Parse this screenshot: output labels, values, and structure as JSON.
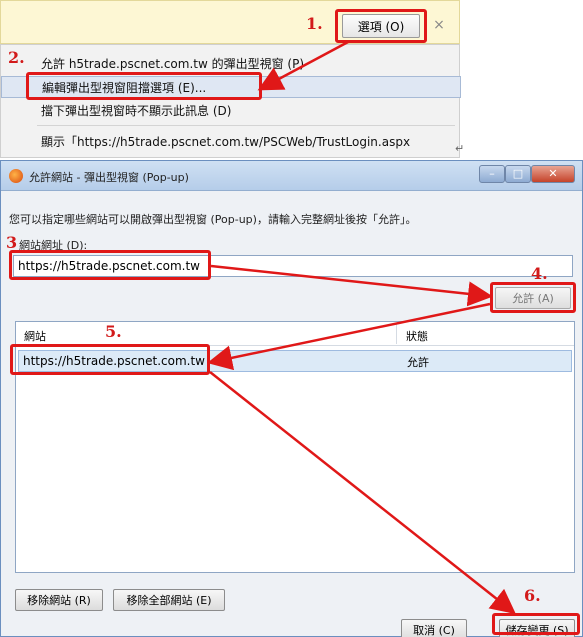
{
  "notification": {
    "options_button": "選項 (O)",
    "close_glyph": "×"
  },
  "menu": {
    "allow_item": "允許 h5trade.pscnet.com.tw 的彈出型視窗 (P)",
    "edit_item": "編輯彈出型視窗阻擋選項 (E)...",
    "hide_item": "擋下彈出型視窗時不顯示此訊息 (D)",
    "show_item": "顯示「https://h5trade.pscnet.com.tw/PSCWeb/TrustLogin.aspx"
  },
  "dialog": {
    "title": "允許網站 - 彈出型視窗 (Pop-up)",
    "instruction": "您可以指定哪些網站可以開啟彈出型視窗 (Pop-up)，請輸入完整網址後按「允許」。",
    "site_label": "網站網址 (D):",
    "site_input_value": "https://h5trade.pscnet.com.tw",
    "allow_button": "允許 (A)",
    "list": {
      "columns": [
        "網站",
        "狀態"
      ],
      "rows": [
        {
          "site": "https://h5trade.pscnet.com.tw",
          "status": "允許"
        }
      ]
    },
    "remove_site_button": "移除網站 (R)",
    "remove_all_button": "移除全部網站 (E)",
    "cancel_button": "取消 (C)",
    "save_button": "儲存變更 (S)"
  },
  "annotations": {
    "step1": "1.",
    "step2": "2.",
    "step3": "3",
    "step4": "4.",
    "step5": "5.",
    "step6": "6."
  },
  "colors": {
    "annotation_red": "#e01818",
    "selection_blue": "#dceaf7"
  }
}
